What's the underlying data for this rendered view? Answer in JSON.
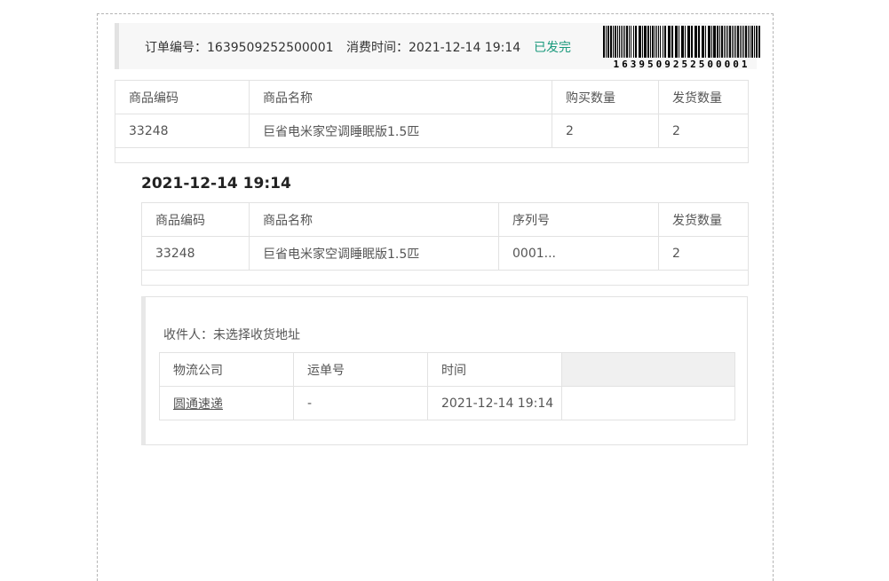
{
  "order": {
    "number_label": "订单编号：",
    "number": "1639509252500001",
    "time_label": "消费时间：",
    "time": "2021-12-14 19:14",
    "status": "已发完",
    "barcode_text": "1639509252500001"
  },
  "goods_table": {
    "headers": [
      "商品编码",
      "商品名称",
      "购买数量",
      "发货数量"
    ],
    "rows": [
      {
        "code": "33248",
        "name": "巨省电米家空调睡眠版1.5匹",
        "buy_qty": "2",
        "ship_qty": "2"
      }
    ]
  },
  "shipment": {
    "time": "2021-12-14 19:14",
    "table": {
      "headers": [
        "商品编码",
        "商品名称",
        "序列号",
        "发货数量"
      ],
      "rows": [
        {
          "code": "33248",
          "name": "巨省电米家空调睡眠版1.5匹",
          "serial": "0001...",
          "ship_qty": "2"
        }
      ]
    },
    "receiver_label": "收件人：",
    "receiver_value": "未选择收货地址",
    "logistics": {
      "headers": [
        "物流公司",
        "运单号",
        "时间",
        ""
      ],
      "rows": [
        {
          "company": "圆通速递",
          "waybill": "-",
          "time": "2021-12-14 19:14",
          "extra": ""
        }
      ]
    }
  },
  "colors": {
    "accent": "#1a9a7c",
    "border": "#e2e2e2",
    "header_bg": "#f7f7f7"
  }
}
